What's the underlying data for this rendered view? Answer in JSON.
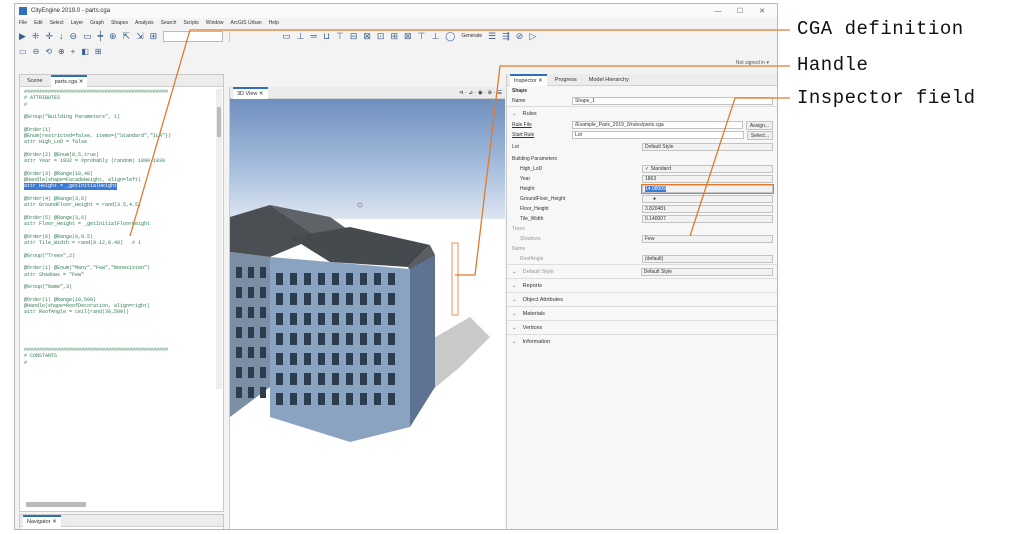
{
  "window": {
    "title": "CityEngine 2019.0 - parts.cga",
    "min": "—",
    "max": "☐",
    "close": "✕"
  },
  "menu": [
    "File",
    "Edit",
    "Select",
    "Layer",
    "Graph",
    "Shapes",
    "Analysis",
    "Search",
    "Scripts",
    "Window",
    "ArcGIS Urban",
    "Help"
  ],
  "toolbar": {
    "icons": [
      "▶",
      "⁜",
      "✛",
      "↓",
      "⊖",
      "▭",
      "┿",
      "⊕",
      "⇱",
      "⇲",
      "⊞",
      "⊕"
    ],
    "right_icons": [
      "▭",
      "⊥",
      "═",
      "⊔",
      "⊤",
      "⊟",
      "⊠",
      "⊡",
      "⊞",
      "⊠",
      "⊤",
      "⊥",
      "◯",
      "☰",
      "⇶",
      "⊘",
      "▷"
    ],
    "generate_label": "Generate",
    "row2_icons": [
      "▭",
      "⊖",
      "⟲",
      "⊕",
      "+",
      "◧",
      "⊞"
    ]
  },
  "signin": "Not signed in ▾",
  "left_panel": {
    "tabs": [
      "Scene",
      "parts.cga ✕"
    ],
    "code": [
      "################################################",
      "# ATTRIBUTES",
      "#",
      "",
      "@Group(\"Building Parameters\", 1)",
      "",
      "@Order(1)",
      "@Enum(restricted=false, items={\"Standard\",\"ILA\"})",
      "attr High_LoD = false",
      "",
      "@Order(2) @Enum(0,5,true)",
      "attr Year = 1932 = #probably (random) 1890-1930",
      "",
      "@Order(3) @Range(10,40)",
      "@Handle(shape=FacadeHeight, align=left)",
      "attr Height = _getInitialHeight",
      "",
      "@Order(4) @Range(3,6)",
      "attr GroundFloor_Height = rand(3.5,4.5)",
      "",
      "@Order(5) @Range(3,6)",
      "attr Floor_Height = _getInitialFloorHeight",
      "",
      "@Order(6) @Range(0,0.5)",
      "attr Tile_Width = rand(0.12,0.48)   # 1",
      "",
      "@Group(\"Trees\",2)",
      "",
      "@Order(1) @Enum(\"Many\",\"Few\",\"Nonexisten\")",
      "attr Shadows = \"Few\"",
      "",
      "@Group(\"Name\",3)",
      "",
      "@Order(1) @Range(10,500)",
      "@Handle(shape=RoofDecoration, align=right)",
      "attr RoofAngle = ceil(rand(30,500))",
      "",
      "",
      "",
      "",
      "",
      "################################################",
      "# CONSTANTS",
      "#"
    ],
    "highlight_line": 15,
    "navigator_tab": "Navigator ✕"
  },
  "viewport": {
    "tab": "3D View ✕",
    "tools": "⊲ · ⊿ · ◉ · ⊕ · ☰"
  },
  "inspector": {
    "tabs": [
      "Inspector ✕",
      "Progress",
      "Model Hierarchy"
    ],
    "shape_header": "Shape",
    "name_label": "Name",
    "name_value": "Shape_1",
    "rules_header": "Rules",
    "rule_file_label": "Rule File",
    "rule_file_value": "/Example_Paris_2019_0/rules/parts.cga",
    "assign_btn": "Assign...",
    "start_rule_label": "Start Rule",
    "start_rule_value": "Lot",
    "select_btn": "Select...",
    "lot_label": "Lot",
    "lot_style": "Default Style",
    "building_params": "Building Parameters",
    "params": [
      {
        "label": "High_LoD",
        "value": "✓ Standard",
        "dd": true
      },
      {
        "label": "Year",
        "value": "1863",
        "dd": true
      },
      {
        "label": "Height",
        "value": "14.08009",
        "dd": true,
        "selected": true
      },
      {
        "label": "GroundFloor_Height",
        "value": "",
        "dd": true,
        "slider": true
      },
      {
        "label": "Floor_Height",
        "value": "3.820481",
        "dd": true
      },
      {
        "label": "Tile_Width",
        "value": "0.140007",
        "dd": true
      }
    ],
    "trees_label": "Trees",
    "shadows_label": "Shadows",
    "shadows_value": "Few",
    "name_grp": "Name",
    "roof_label": "RoofAngle",
    "roof_value": "(default)",
    "default_row_label": "Default Style",
    "default_row_value": "Default Style",
    "sections": [
      "Reports",
      "Object Attributes",
      "Materials",
      "Vertices",
      "Information"
    ]
  },
  "annotations": {
    "cga": "CGA definition",
    "handle": "Handle",
    "inspector": "Inspector field"
  }
}
